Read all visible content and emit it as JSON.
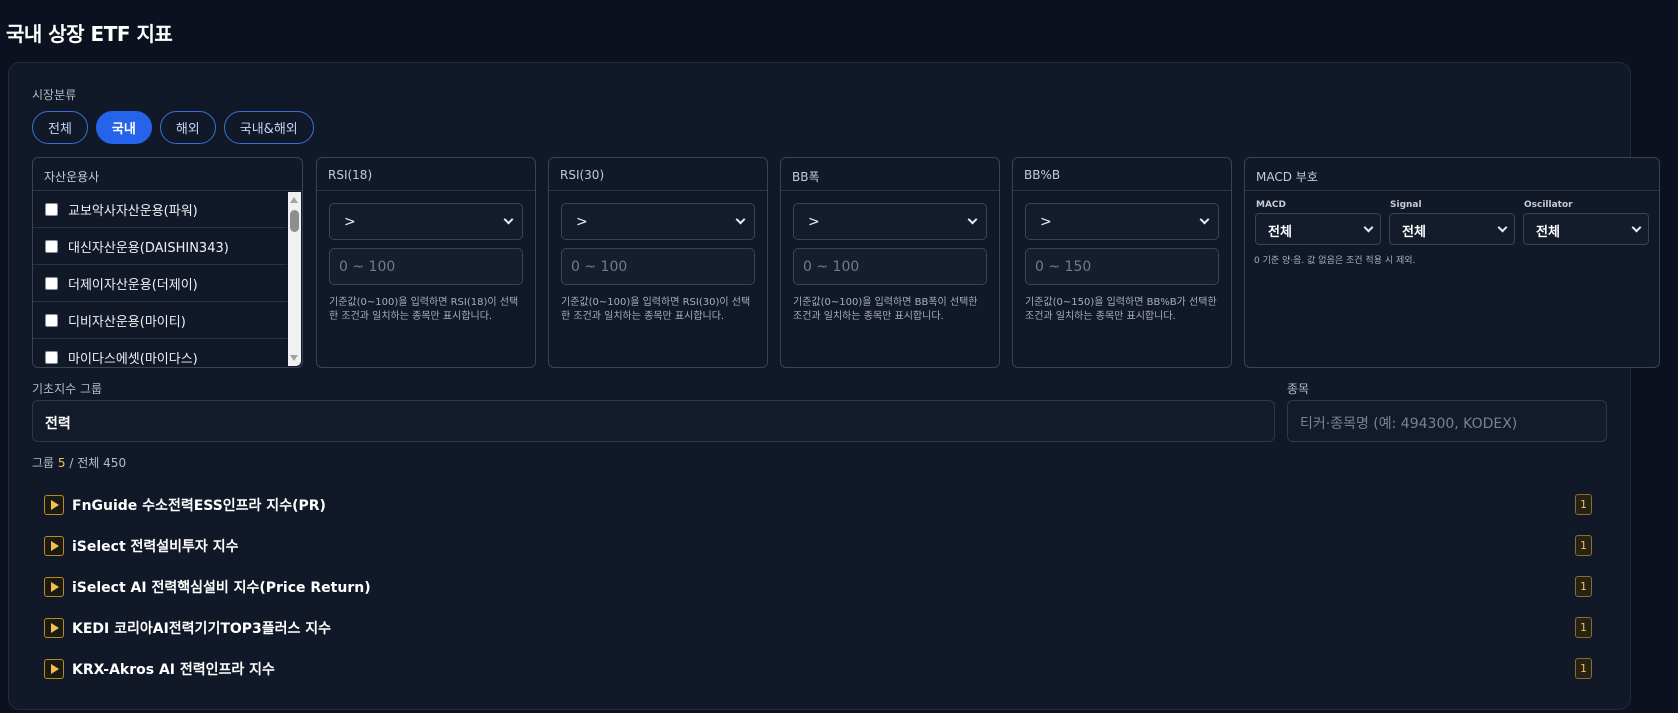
{
  "page_title": "국내 상장 ETF 지표",
  "market": {
    "label": "시장분류",
    "options": [
      "전체",
      "국내",
      "해외",
      "국내&해외"
    ],
    "selected": "국내"
  },
  "asset_managers": {
    "label": "자산운용사",
    "items": [
      "교보악사자산운용(파워)",
      "대신자산운용(DAISHIN343)",
      "더제이자산운용(더제이)",
      "디비자산운용(마이티)",
      "마이다스에셋(마이다스)"
    ]
  },
  "filters": {
    "rsi18": {
      "label": "RSI(18)",
      "operator": ">",
      "placeholder": "0 ~ 100",
      "hint": "기준값(0~100)을 입력하면 RSI(18)이 선택한 조건과 일치하는 종목만 표시합니다."
    },
    "rsi30": {
      "label": "RSI(30)",
      "operator": ">",
      "placeholder": "0 ~ 100",
      "hint": "기준값(0~100)을 입력하면 RSI(30)이 선택한 조건과 일치하는 종목만 표시합니다."
    },
    "bbw": {
      "label": "BB폭",
      "operator": ">",
      "placeholder": "0 ~ 100",
      "hint": "기준값(0~100)을 입력하면 BB폭이 선택한 조건과 일치하는 종목만 표시합니다."
    },
    "bbpb": {
      "label": "BB%B",
      "operator": ">",
      "placeholder": "0 ~ 150",
      "hint": "기준값(0~150)을 입력하면 BB%B가 선택한 조건과 일치하는 종목만 표시합니다."
    }
  },
  "macd": {
    "label": "MACD 부호",
    "macd_label": "MACD",
    "macd_value": "전체",
    "signal_label": "Signal",
    "signal_value": "전체",
    "osc_label": "Oscillator",
    "osc_value": "전체",
    "note": "0 기준 양·음. 값 없음은 조건 적용 시 제외."
  },
  "base_index": {
    "label": "기초지수 그룹",
    "value": "전력"
  },
  "ticker": {
    "label": "종목",
    "placeholder": "티커·종목명 (예: 494300, KODEX)"
  },
  "counts": {
    "prefix": "그룹",
    "group_count": "5",
    "separator": "/ 전체",
    "total": "450"
  },
  "groups": [
    {
      "name": "FnGuide 수소전력ESS인프라 지수(PR)",
      "count": "1"
    },
    {
      "name": "iSelect 전력설비투자 지수",
      "count": "1"
    },
    {
      "name": "iSelect AI 전력핵심설비 지수(Price Return)",
      "count": "1"
    },
    {
      "name": "KEDI 코리아AI전력기기TOP3플러스 지수",
      "count": "1"
    },
    {
      "name": "KRX-Akros AI 전력인프라 지수",
      "count": "1"
    }
  ],
  "colors": {
    "accent": "#2563eb",
    "highlight": "#f0c24b",
    "background": "#0c1120"
  }
}
